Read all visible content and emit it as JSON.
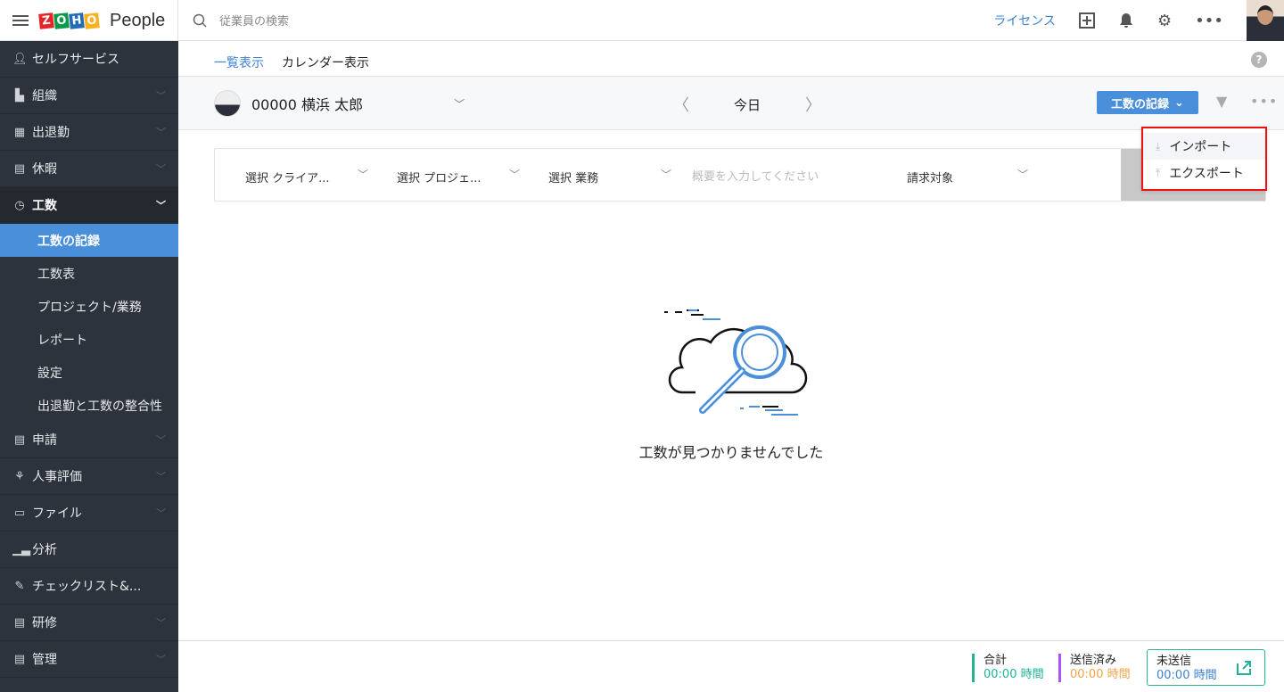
{
  "header": {
    "app_name": "People",
    "logo_letters": [
      "Z",
      "O",
      "H",
      "O"
    ],
    "logo_colors": [
      "#e42527",
      "#089949",
      "#226db4",
      "#f9b21d"
    ],
    "search_placeholder": "従業員の検索",
    "license_link": "ライセンス"
  },
  "sidebar": {
    "items": [
      {
        "label": "セルフサービス",
        "icon": "user-icon"
      },
      {
        "label": "組織",
        "icon": "building-icon"
      },
      {
        "label": "出退勤",
        "icon": "calendar-icon"
      },
      {
        "label": "休暇",
        "icon": "leave-icon"
      },
      {
        "label": "工数",
        "icon": "clock-icon",
        "active": true
      }
    ],
    "sub_items": [
      "工数の記録",
      "工数表",
      "プロジェクト/業務",
      "レポート",
      "設定",
      "出退勤と工数の整合性"
    ],
    "items_after": [
      {
        "label": "申請",
        "icon": "document-icon"
      },
      {
        "label": "人事評価",
        "icon": "appraisal-icon"
      },
      {
        "label": "ファイル",
        "icon": "file-icon"
      },
      {
        "label": "分析",
        "icon": "chart-icon"
      },
      {
        "label": "チェックリスト&...",
        "icon": "checklist-icon"
      },
      {
        "label": "研修",
        "icon": "training-icon"
      },
      {
        "label": "管理",
        "icon": "admin-icon"
      }
    ]
  },
  "tabs": [
    "一覧表示",
    "カレンダー表示"
  ],
  "toolbar": {
    "employee": "00000 横浜 太郎",
    "period": "今日",
    "record_button": "工数の記録"
  },
  "menu": {
    "items": [
      "インポート",
      "エクスポート"
    ]
  },
  "form": {
    "client": "選択 クライア...",
    "project": "選択 プロジェ...",
    "job": "選択 業務",
    "description_placeholder": "概要を入力してください",
    "billable": "請求対象"
  },
  "empty": {
    "message": "工数が見つかりませんでした"
  },
  "footer": {
    "total_label": "合計",
    "total_value": "00:00 時間",
    "submitted_label": "送信済み",
    "submitted_value": "00:00 時間",
    "unsent_label": "未送信",
    "unsent_value": "00:00 時間",
    "colors": {
      "total": "#1db396",
      "submitted": "#f5a34a",
      "unsent": "#3b82d4",
      "submitted_bar": "#a855f7"
    }
  }
}
